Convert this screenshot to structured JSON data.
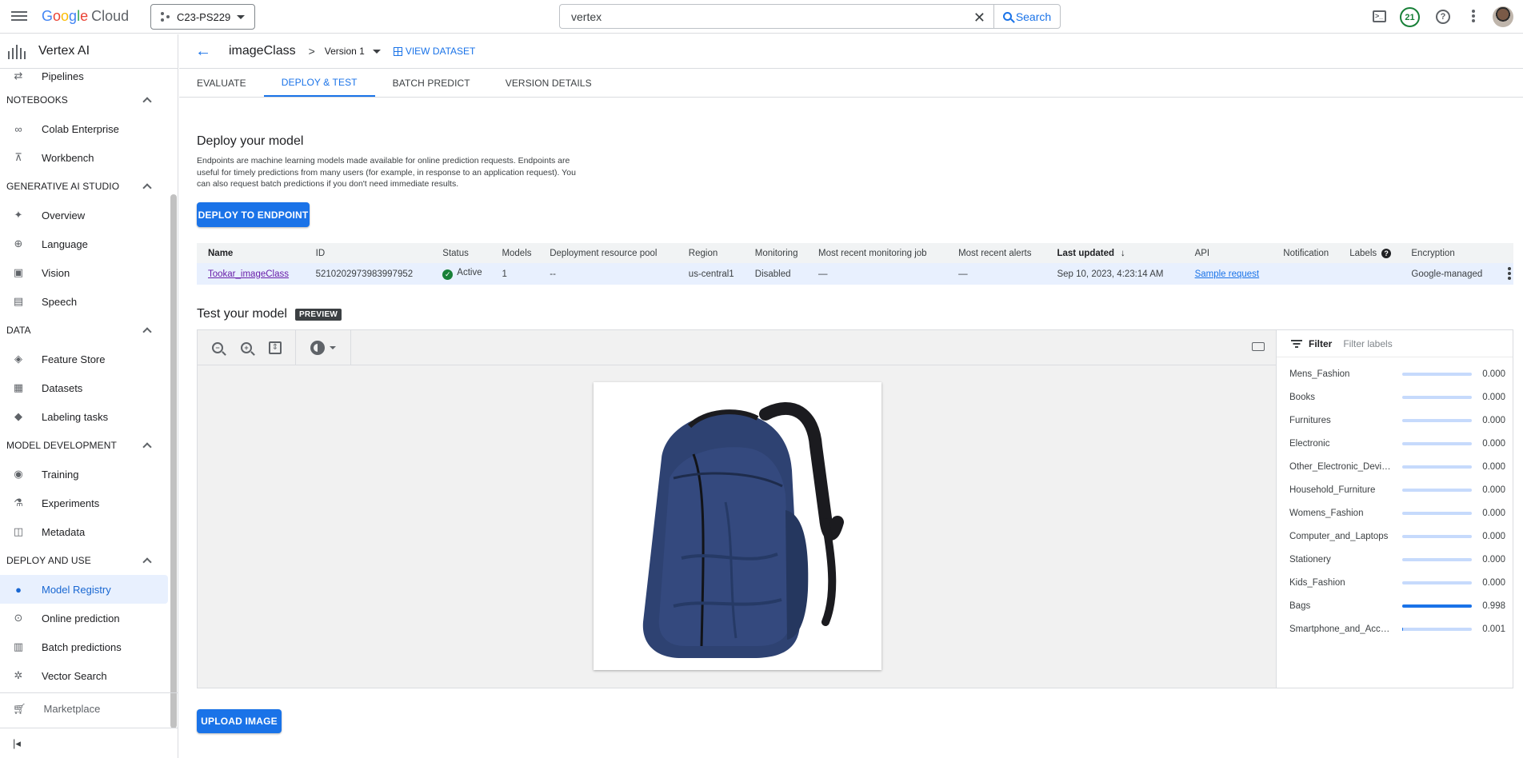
{
  "topbar": {
    "logo_letters": [
      "G",
      "o",
      "o",
      "g",
      "l",
      "e"
    ],
    "logo_suffix": "Cloud",
    "project": "C23-PS229",
    "search_value": "vertex",
    "search_button": "Search",
    "notification_count": "21"
  },
  "sidebar": {
    "title": "Vertex AI",
    "partial_item": "Pipelines",
    "sections": [
      {
        "title": "NOTEBOOKS",
        "items": [
          "Colab Enterprise",
          "Workbench"
        ]
      },
      {
        "title": "GENERATIVE AI STUDIO",
        "items": [
          "Overview",
          "Language",
          "Vision",
          "Speech"
        ]
      },
      {
        "title": "DATA",
        "items": [
          "Feature Store",
          "Datasets",
          "Labeling tasks"
        ]
      },
      {
        "title": "MODEL DEVELOPMENT",
        "items": [
          "Training",
          "Experiments",
          "Metadata"
        ]
      },
      {
        "title": "DEPLOY AND USE",
        "items": [
          "Model Registry",
          "Online prediction",
          "Batch predictions",
          "Vector Search"
        ]
      }
    ],
    "active_item": "Model Registry",
    "marketplace": "Marketplace"
  },
  "breadcrumb": {
    "model": "imageClass",
    "version": "Version 1",
    "view_dataset": "VIEW DATASET"
  },
  "tabs": [
    "EVALUATE",
    "DEPLOY & TEST",
    "BATCH PREDICT",
    "VERSION DETAILS"
  ],
  "active_tab": "DEPLOY & TEST",
  "deploy": {
    "title": "Deploy your model",
    "description": "Endpoints are machine learning models made available for online prediction requests. Endpoints are useful for timely predictions from many users (for example, in response to an application request). You can also request batch predictions if you don't need immediate results.",
    "button": "DEPLOY TO ENDPOINT"
  },
  "endpoints": {
    "columns": [
      "Name",
      "ID",
      "Status",
      "Models",
      "Deployment resource pool",
      "Region",
      "Monitoring",
      "Most recent monitoring job",
      "Most recent alerts",
      "Last updated",
      "API",
      "Notification",
      "Labels",
      "Encryption"
    ],
    "row": {
      "name": "Tookar_imageClass",
      "id": "5210202973983997952",
      "status": "Active",
      "models": "1",
      "pool": "--",
      "region": "us-central1",
      "monitoring": "Disabled",
      "monitoring_job": "—",
      "alerts": "—",
      "last_updated": "Sep 10, 2023, 4:23:14 AM",
      "api": "Sample request",
      "notification": "",
      "labels": "",
      "encryption": "Google-managed"
    }
  },
  "test": {
    "title": "Test your model",
    "badge": "PREVIEW",
    "filter_label": "Filter",
    "filter_placeholder": "Filter labels",
    "upload_button": "UPLOAD IMAGE",
    "predictions": [
      {
        "label": "Mens_Fashion",
        "score": "0.000",
        "value": 0.0
      },
      {
        "label": "Books",
        "score": "0.000",
        "value": 0.0
      },
      {
        "label": "Furnitures",
        "score": "0.000",
        "value": 0.0
      },
      {
        "label": "Electronic",
        "score": "0.000",
        "value": 0.0
      },
      {
        "label": "Other_Electronic_Devices",
        "score": "0.000",
        "value": 0.0
      },
      {
        "label": "Household_Furniture",
        "score": "0.000",
        "value": 0.0
      },
      {
        "label": "Womens_Fashion",
        "score": "0.000",
        "value": 0.0
      },
      {
        "label": "Computer_and_Laptops",
        "score": "0.000",
        "value": 0.0
      },
      {
        "label": "Stationery",
        "score": "0.000",
        "value": 0.0
      },
      {
        "label": "Kids_Fashion",
        "score": "0.000",
        "value": 0.0
      },
      {
        "label": "Bags",
        "score": "0.998",
        "value": 0.998
      },
      {
        "label": "Smartphone_and_Acce...",
        "score": "0.001",
        "value": 0.001
      }
    ]
  },
  "colors": {
    "accent": "#1a73e8",
    "active_bg": "#e8f0fe",
    "status_green": "#188038",
    "visited_link": "#681da8"
  }
}
